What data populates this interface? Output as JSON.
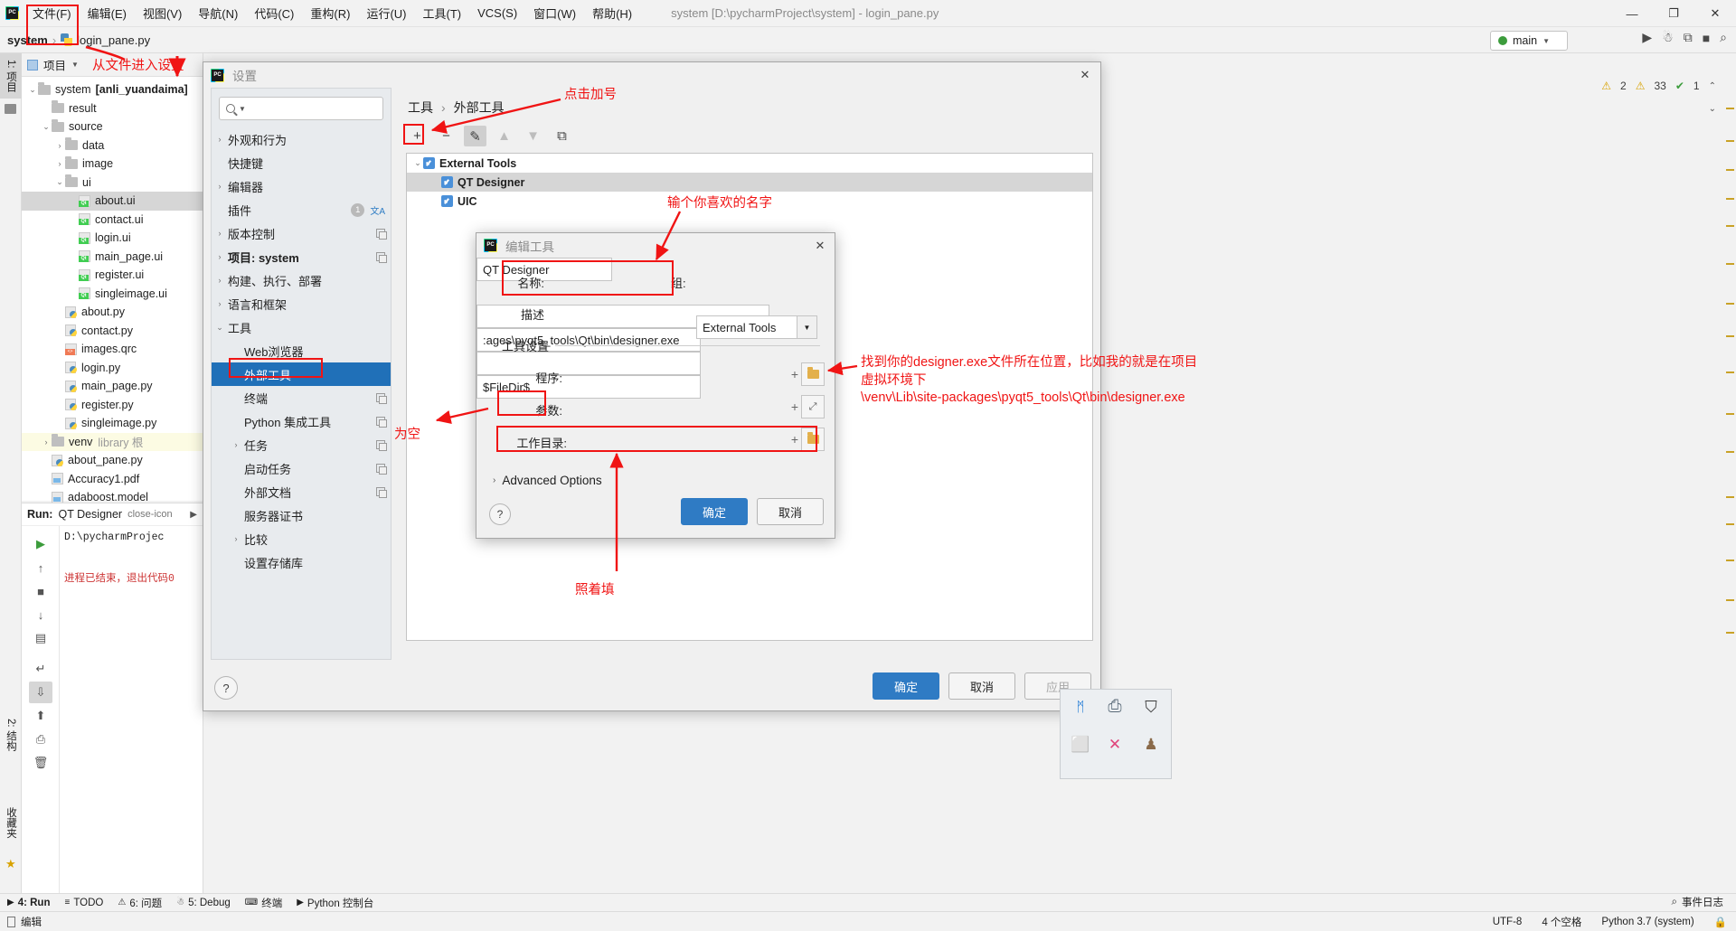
{
  "app": {
    "window_title": "system [D:\\pycharmProject\\system] - login_pane.py",
    "logo": "pycharm-logo"
  },
  "menubar": {
    "items": [
      {
        "label": "文件(F)",
        "mnemonic": "F"
      },
      {
        "label": "编辑(E)",
        "mnemonic": "E"
      },
      {
        "label": "视图(V)",
        "mnemonic": "V"
      },
      {
        "label": "导航(N)",
        "mnemonic": "N"
      },
      {
        "label": "代码(C)",
        "mnemonic": "C"
      },
      {
        "label": "重构(R)",
        "mnemonic": "R"
      },
      {
        "label": "运行(U)",
        "mnemonic": "U"
      },
      {
        "label": "工具(T)",
        "mnemonic": "T"
      },
      {
        "label": "VCS(S)",
        "mnemonic": "S"
      },
      {
        "label": "窗口(W)",
        "mnemonic": "W"
      },
      {
        "label": "帮助(H)",
        "mnemonic": "H"
      }
    ],
    "window_controls": {
      "minimize": "—",
      "maximize": "❐",
      "close": "✕"
    }
  },
  "breadcrumb": {
    "project": "system",
    "separator": "›",
    "file": "login_pane.py"
  },
  "run_config": {
    "label": "main",
    "status_color": "#3c9c3c",
    "dropdown_icon": "chevron-down-icon"
  },
  "nav_icons": [
    {
      "name": "run-icon",
      "glyph": "▶"
    },
    {
      "name": "debug-icon",
      "glyph": "☃"
    },
    {
      "name": "coverage-icon",
      "glyph": "⧉"
    },
    {
      "name": "stop-icon",
      "glyph": "■"
    },
    {
      "name": "search-everywhere-icon",
      "glyph": "⌕"
    }
  ],
  "left_strip": {
    "items": [
      {
        "label": "1: 项目",
        "selected": true
      },
      {
        "label": "2: 结构",
        "selected": false
      },
      {
        "label": "收藏夹",
        "selected": false
      }
    ]
  },
  "project_panel": {
    "title": "项目",
    "dropdown_icon": "chevron-down-icon",
    "tree": [
      {
        "label": "system",
        "suffix": "[anli_yuandaima]",
        "type": "folder",
        "depth": 0,
        "arrow": "⌄",
        "bold_suffix": true
      },
      {
        "label": "result",
        "type": "folder",
        "depth": 1,
        "arrow": ""
      },
      {
        "label": "source",
        "type": "folder",
        "depth": 1,
        "arrow": "⌄"
      },
      {
        "label": "data",
        "type": "folder",
        "depth": 2,
        "arrow": "›"
      },
      {
        "label": "image",
        "type": "folder",
        "depth": 2,
        "arrow": "›"
      },
      {
        "label": "ui",
        "type": "folder",
        "depth": 2,
        "arrow": "⌄"
      },
      {
        "label": "about.ui",
        "type": "qt",
        "depth": 3,
        "arrow": "",
        "selected": true
      },
      {
        "label": "contact.ui",
        "type": "qt",
        "depth": 3,
        "arrow": ""
      },
      {
        "label": "login.ui",
        "type": "qt",
        "depth": 3,
        "arrow": ""
      },
      {
        "label": "main_page.ui",
        "type": "qt",
        "depth": 3,
        "arrow": ""
      },
      {
        "label": "register.ui",
        "type": "qt",
        "depth": 3,
        "arrow": ""
      },
      {
        "label": "singleimage.ui",
        "type": "qt",
        "depth": 3,
        "arrow": ""
      },
      {
        "label": "about.py",
        "type": "py",
        "depth": 2,
        "arrow": ""
      },
      {
        "label": "contact.py",
        "type": "py",
        "depth": 2,
        "arrow": ""
      },
      {
        "label": "images.qrc",
        "type": "qrc",
        "depth": 2,
        "arrow": ""
      },
      {
        "label": "login.py",
        "type": "py",
        "depth": 2,
        "arrow": ""
      },
      {
        "label": "main_page.py",
        "type": "py",
        "depth": 2,
        "arrow": ""
      },
      {
        "label": "register.py",
        "type": "py",
        "depth": 2,
        "arrow": ""
      },
      {
        "label": "singleimage.py",
        "type": "py",
        "depth": 2,
        "arrow": ""
      },
      {
        "label": "venv",
        "suffix": "library 根",
        "type": "folder",
        "depth": 1,
        "arrow": "›",
        "highlight": true
      },
      {
        "label": "about_pane.py",
        "type": "py",
        "depth": 1,
        "arrow": ""
      },
      {
        "label": "Accuracy1.pdf",
        "type": "pdf",
        "depth": 1,
        "arrow": ""
      },
      {
        "label": "adaboost.model",
        "type": "pdf",
        "depth": 1,
        "arrow": ""
      }
    ]
  },
  "run_panel": {
    "title_label": "Run:",
    "config_name": "QT Designer",
    "close_icon": "close-icon",
    "next_icon": "▶",
    "output_line1": "D:\\pycharmProjec",
    "output_line2": "进程已结束，退出代码0",
    "side_buttons": [
      {
        "name": "rerun-button",
        "glyph": "▶"
      },
      {
        "name": "scroll-up-button",
        "glyph": "↑"
      },
      {
        "name": "stop-button",
        "glyph": "■"
      },
      {
        "name": "scroll-down-button",
        "glyph": "↓"
      },
      {
        "name": "layout-button",
        "glyph": "▤"
      },
      {
        "name": "wrap-button",
        "glyph": "↵"
      },
      {
        "name": "scroll-end-button",
        "glyph": "⇩"
      },
      {
        "name": "pin-button",
        "glyph": "⬆"
      },
      {
        "name": "print-button",
        "glyph": "⎙"
      },
      {
        "name": "clear-button",
        "glyph": "🗑"
      }
    ]
  },
  "inspection": {
    "warnings": "2",
    "weak_warnings": "33",
    "checks_ok": "1",
    "warn_icon": "warning-triangle-icon",
    "weak_icon": "weak-warning-icon",
    "ok_icon": "check-icon",
    "collapse_icon": "chevron-up-icon"
  },
  "settings_dialog": {
    "title": "设置",
    "close_icon": "close-icon",
    "search_placeholder": "",
    "search_icon": "search-icon",
    "nav": [
      {
        "label": "外观和行为",
        "arrow": "›"
      },
      {
        "label": "快捷键",
        "arrow": ""
      },
      {
        "label": "编辑器",
        "arrow": "›"
      },
      {
        "label": "插件",
        "arrow": "",
        "badge": "1",
        "extra_icon": "translate-icon"
      },
      {
        "label": "版本控制",
        "arrow": "›",
        "copy_icon": true
      },
      {
        "label": "项目: system",
        "arrow": "›",
        "copy_icon": true,
        "bold_tail": true
      },
      {
        "label": "构建、执行、部署",
        "arrow": "›"
      },
      {
        "label": "语言和框架",
        "arrow": "›"
      },
      {
        "label": "工具",
        "arrow": "⌄"
      },
      {
        "label": "Web浏览器",
        "arrow": "",
        "indent": true
      },
      {
        "label": "外部工具",
        "arrow": "",
        "indent": true,
        "selected": true
      },
      {
        "label": "终端",
        "arrow": "",
        "indent": true,
        "copy_icon": true
      },
      {
        "label": "Python 集成工具",
        "arrow": "",
        "indent": true,
        "copy_icon": true
      },
      {
        "label": "任务",
        "arrow": "›",
        "indent": true,
        "copy_icon": true
      },
      {
        "label": "启动任务",
        "arrow": "",
        "indent": true,
        "copy_icon": true
      },
      {
        "label": "外部文档",
        "arrow": "",
        "indent": true,
        "copy_icon": true
      },
      {
        "label": "服务器证书",
        "arrow": "",
        "indent": true
      },
      {
        "label": "比较",
        "arrow": "›",
        "indent": true
      },
      {
        "label": "设置存储库",
        "arrow": "",
        "indent": true
      }
    ],
    "breadcrumb": [
      "工具",
      "外部工具"
    ],
    "breadcrumb_sep": "›",
    "toolbar": [
      {
        "name": "add-tool-button",
        "glyph": "+",
        "state": "normal"
      },
      {
        "name": "remove-tool-button",
        "glyph": "−",
        "state": "normal"
      },
      {
        "name": "edit-tool-button",
        "glyph": "✎",
        "state": "active"
      },
      {
        "name": "move-up-button",
        "glyph": "▲",
        "state": "disabled"
      },
      {
        "name": "move-down-button",
        "glyph": "▼",
        "state": "disabled"
      },
      {
        "name": "copy-tool-button",
        "glyph": "⧉",
        "state": "normal"
      }
    ],
    "tool_list": [
      {
        "label": "External Tools",
        "depth": 0,
        "arrow": "⌄",
        "checked": true,
        "bold": true
      },
      {
        "label": "QT Designer",
        "depth": 1,
        "arrow": "",
        "checked": true,
        "bold": true,
        "selected": true
      },
      {
        "label": "UIC",
        "depth": 1,
        "arrow": "",
        "checked": true,
        "bold": true
      }
    ],
    "buttons": {
      "ok": "确定",
      "cancel": "取消",
      "apply": "应用",
      "apply_disabled": true,
      "help": "?"
    }
  },
  "edit_tool_dialog": {
    "title": "编辑工具",
    "close_icon": "close-icon",
    "fields": {
      "name_label": "名称:",
      "name_value": "QT Designer",
      "group_label": "组:",
      "group_value": "External Tools",
      "desc_label": "描述",
      "desc_value": "",
      "section_label": "工具设置",
      "program_label": "程序:",
      "program_value": ":ages\\pyqt5_tools\\Qt\\bin\\designer.exe",
      "arguments_label": "参数:",
      "arguments_value": "",
      "workdir_label": "工作目录:",
      "workdir_value": "$FileDir$",
      "advanced_label": "Advanced Options",
      "advanced_arrow": "›"
    },
    "buttons": {
      "ok": "确定",
      "cancel": "取消",
      "help": "?"
    },
    "icons": {
      "insert_macro": "+",
      "browse": "folder-icon",
      "expand": "expand-icon"
    }
  },
  "annotations": {
    "accent_color": "#f01414",
    "notes": [
      {
        "id": "enter-settings-from-file",
        "text": "从文件进入设置"
      },
      {
        "id": "click-plus",
        "text": "点击加号"
      },
      {
        "id": "type-favorite-name",
        "text": "输个你喜欢的名字"
      },
      {
        "id": "locate-designer-exe",
        "text": "找到你的designer.exe文件所在位置，比如我的就是在项目\n虚拟环境下\n\\venv\\Lib\\site-packages\\pyqt5_tools\\Qt\\bin\\designer.exe"
      },
      {
        "id": "leave-empty",
        "text": "为空"
      },
      {
        "id": "fill-as-shown",
        "text": "照着填"
      }
    ]
  },
  "bottom_toolwindows": [
    {
      "label": "4: Run",
      "icon": "▶",
      "selected": true
    },
    {
      "label": "TODO",
      "icon": "≡",
      "selected": false
    },
    {
      "label": "6: 问题",
      "icon": "⚠",
      "selected": false
    },
    {
      "label": "5: Debug",
      "icon": "☃",
      "selected": false
    },
    {
      "label": "终端",
      "icon": "⌨",
      "selected": false
    },
    {
      "label": "Python 控制台",
      "icon": "▶",
      "selected": false
    }
  ],
  "event_log": {
    "label": "事件日志",
    "icon": "⌕"
  },
  "statusbar": {
    "left_label": "编辑",
    "left_icon": "edit-icon",
    "encoding": "UTF-8",
    "indent": "4 个空格",
    "interpreter": "Python 3.7 (system)",
    "lock_icon": "lock-icon"
  },
  "tray": {
    "items": [
      {
        "name": "bluetooth-icon",
        "glyph": "ᛗ"
      },
      {
        "name": "printer-icon",
        "glyph": "⎙"
      },
      {
        "name": "shield-icon",
        "glyph": "⛉"
      },
      {
        "name": "monitor-icon",
        "glyph": "⬜"
      },
      {
        "name": "network-icon",
        "glyph": "✕"
      },
      {
        "name": "user-icon",
        "glyph": "♟"
      }
    ]
  }
}
